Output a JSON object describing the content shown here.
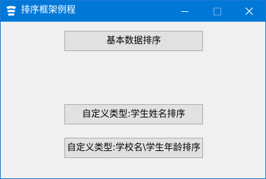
{
  "window": {
    "title": "排序框架例程",
    "app_icon": "app-icon",
    "controls": {
      "minimize_icon": "minimize-icon",
      "maximize_icon": "maximize-icon",
      "close_icon": "close-icon"
    }
  },
  "buttons": {
    "basic_sort": "基本数据排序",
    "custom_name_sort": "自定义类型:学生姓名排序",
    "custom_school_age_sort": "自定义类型:学校名\\学生年龄排序"
  },
  "colors": {
    "titlebar": "#0078d7",
    "window_bg": "#f0f0f0",
    "button_bg": "#e1e1e1",
    "button_border": "#adadad"
  }
}
